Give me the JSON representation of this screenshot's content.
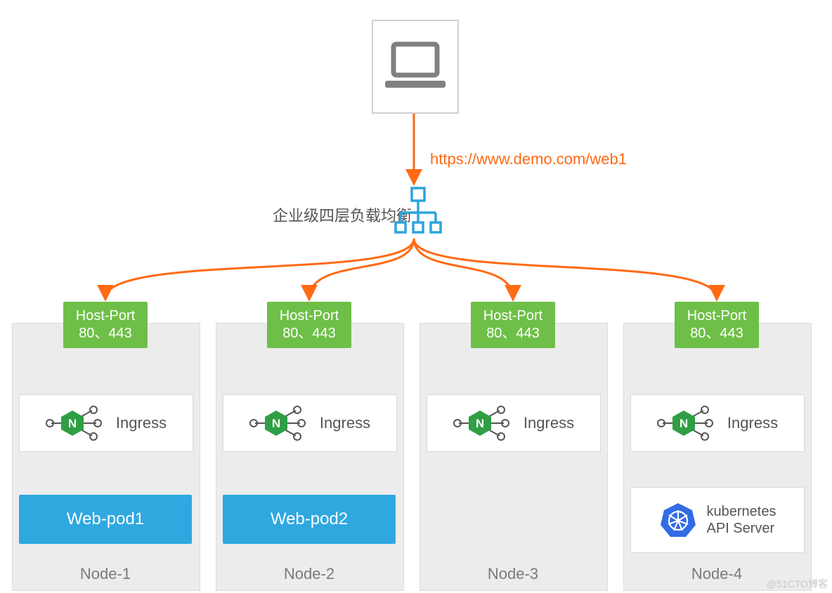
{
  "url_label": "https://www.demo.com/web1",
  "load_balancer_label": "企业级四层负载均衡",
  "host_port": {
    "title": "Host-Port",
    "ports": "80、443"
  },
  "ingress_label": "Ingress",
  "pods": [
    "Web-pod1",
    "Web-pod2"
  ],
  "nodes": [
    "Node-1",
    "Node-2",
    "Node-3",
    "Node-4"
  ],
  "k8s": {
    "line1": "kubernetes",
    "line2": "API Server"
  },
  "watermark": "@51CTO博客",
  "colors": {
    "orange": "#ff6a13",
    "blue_lb": "#2aa5dc",
    "green_hp": "#6ebf47",
    "nginx_green": "#2f9e44",
    "pod_blue": "#2fa8e0",
    "node_gray": "#ececec",
    "k8s_blue": "#326ce5"
  }
}
